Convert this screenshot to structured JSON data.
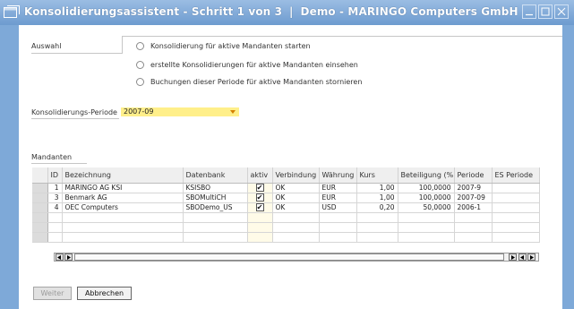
{
  "window": {
    "title_main": "Konsolidierungsassistent - Schritt 1 von 3",
    "title_sep": "|",
    "title_company": "Demo - MARINGO Computers GmbH"
  },
  "auswahl": {
    "label": "Auswahl",
    "options": [
      "Konsolidierung für aktive Mandanten starten",
      "erstellte Konsolidierungen für aktive Mandanten einsehen",
      "Buchungen dieser Periode für aktive Mandanten stornieren"
    ]
  },
  "periode": {
    "label": "Konsolidierungs-Periode",
    "value": "2007-09"
  },
  "mandanten": {
    "label": "Mandanten",
    "columns": [
      "",
      "ID",
      "Bezeichnung",
      "Datenbank",
      "aktiv",
      "Verbindung",
      "Währung",
      "Kurs",
      "Beteiligung (%)",
      "Periode",
      "ES Periode"
    ],
    "rows": [
      {
        "id": "1",
        "bezeichnung": "MARINGO AG KSI",
        "datenbank": "KSISBO",
        "aktiv": "✔",
        "verbindung": "OK",
        "waehrung": "EUR",
        "kurs": "1,00",
        "beteiligung": "100,0000",
        "periode": "2007-9",
        "es_periode": ""
      },
      {
        "id": "3",
        "bezeichnung": "Benmark AG",
        "datenbank": "SBOMultiCH",
        "aktiv": "✔",
        "verbindung": "OK",
        "waehrung": "EUR",
        "kurs": "1,00",
        "beteiligung": "100,0000",
        "periode": "2007-09",
        "es_periode": ""
      },
      {
        "id": "4",
        "bezeichnung": "OEC Computers",
        "datenbank": "SBODemo_US",
        "aktiv": "✔",
        "verbindung": "OK",
        "waehrung": "USD",
        "kurs": "0,20",
        "beteiligung": "50,0000",
        "periode": "2006-1",
        "es_periode": ""
      }
    ]
  },
  "buttons": {
    "weiter": "Weiter",
    "abbrechen": "Abbrechen"
  },
  "icons": {
    "window": "window-icon",
    "minimize": "minimize-icon",
    "maximize": "maximize-icon",
    "close": "close-icon"
  },
  "colors": {
    "title_bar": "#7ea9d8",
    "period_field": "#ffef8a",
    "period_caret": "#d58000"
  }
}
